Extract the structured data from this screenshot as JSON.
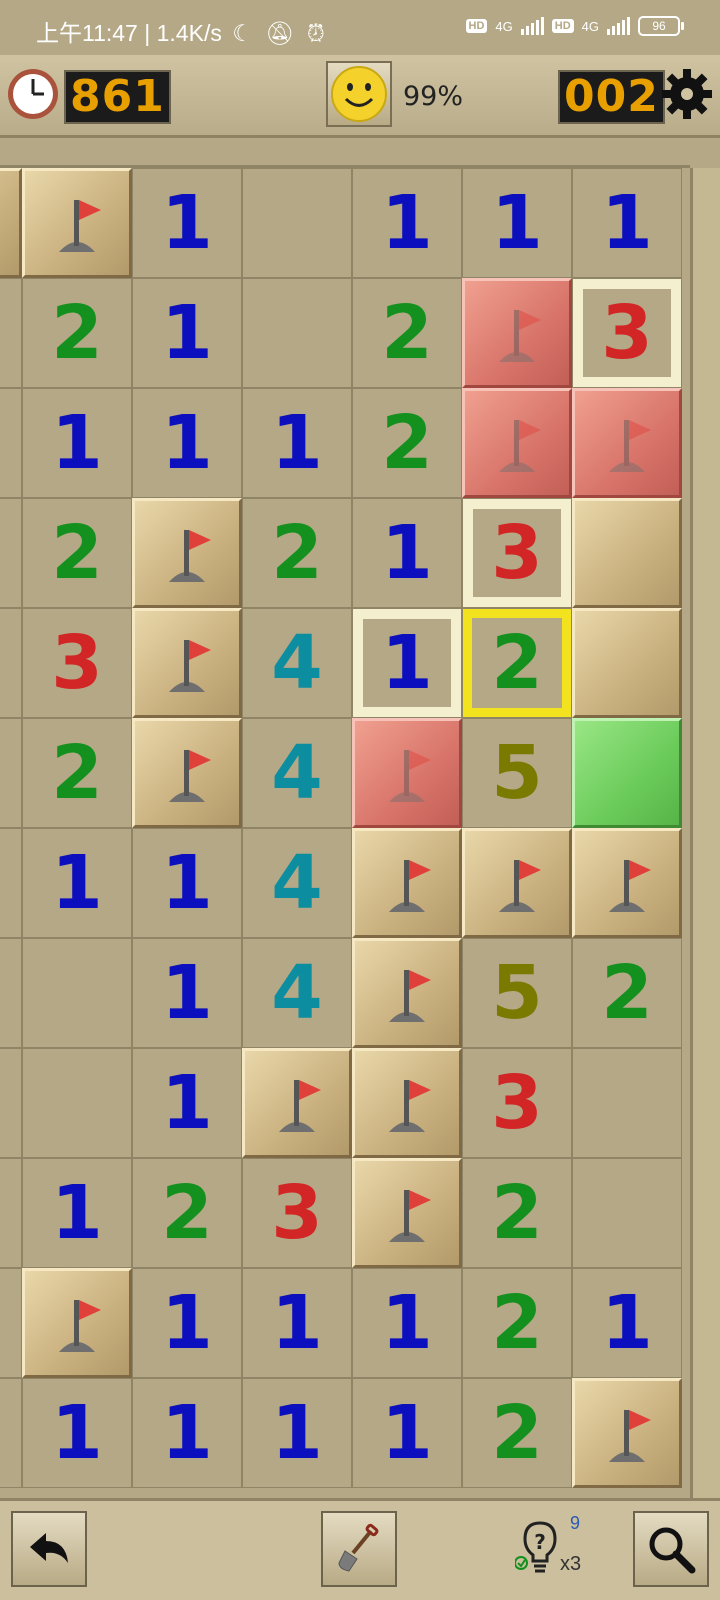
{
  "status_bar": {
    "time": "上午11:47",
    "net_speed": "1.4K/s",
    "hd1": "HD",
    "sig1": "4G",
    "hd2": "HD",
    "sig2": "4G",
    "battery": "96"
  },
  "header": {
    "timer": "861",
    "percent": "99%",
    "mines_left": "002",
    "icons": [
      "clock-icon",
      "smiley-icon",
      "gear-icon"
    ]
  },
  "board": {
    "rows": [
      [
        "raised",
        "flag",
        "1",
        "",
        "1",
        "1",
        "1"
      ],
      [
        "",
        "2",
        "1",
        "",
        "2",
        "red-flag",
        "3*"
      ],
      [
        "",
        "1",
        "1",
        "1",
        "2",
        "red-flag",
        "red-flag"
      ],
      [
        "",
        "2",
        "flag",
        "2",
        "1",
        "3*",
        "raised"
      ],
      [
        "",
        "3",
        "flag",
        "4",
        "1*",
        "2#",
        "raised"
      ],
      [
        "",
        "2",
        "flag",
        "4",
        "red-flag",
        "5",
        "green"
      ],
      [
        "",
        "1",
        "1",
        "4",
        "flag",
        "flag",
        "flag"
      ],
      [
        "",
        "",
        "1",
        "4",
        "flag",
        "5",
        "2"
      ],
      [
        "",
        "",
        "1",
        "flag",
        "flag",
        "3",
        ""
      ],
      [
        "",
        "1",
        "2",
        "3",
        "flag",
        "2",
        ""
      ],
      [
        "",
        "flag",
        "1",
        "1",
        "1",
        "2",
        "1"
      ],
      [
        "",
        "1",
        "1",
        "1",
        "1",
        "2",
        "flag"
      ]
    ],
    "legend_note": "* soft highlight, # yellow highlight"
  },
  "toolbar": {
    "hint_count": "9",
    "hint_multiplier": "x3",
    "icons": [
      "undo-icon",
      "shovel-icon",
      "hint-bulb-icon",
      "magnifier-icon"
    ]
  }
}
